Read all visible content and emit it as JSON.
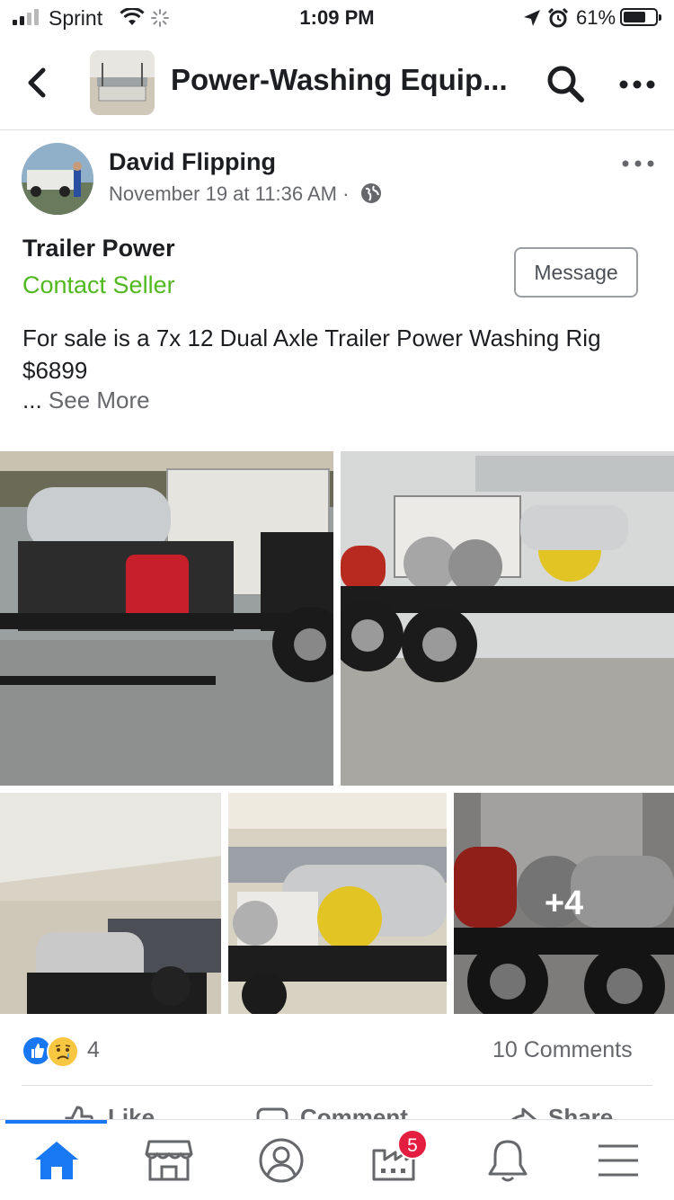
{
  "status_bar": {
    "carrier": "Sprint",
    "time": "1:09 PM",
    "battery": "61%"
  },
  "header": {
    "group_title": "Power-Washing Equip..."
  },
  "post": {
    "author": "David Flipping",
    "timestamp": "November 19 at 11:36 AM ·",
    "listing_title": "Trailer Power",
    "contact_label": "Contact Seller",
    "message_label": "Message",
    "description": "For sale is  a 7x 12 Dual Axle Trailer Power Washing Rig $6899",
    "see_more_dots": "...",
    "see_more_label": "See More",
    "extra_photos": "+4"
  },
  "engagement": {
    "reaction_count": "4",
    "comments_label": "10 Comments",
    "actions": [
      "Like",
      "Comment",
      "Share"
    ]
  },
  "tabbar": {
    "notification_badge": "5"
  },
  "colors": {
    "accent": "#1877f2",
    "contact_green": "#52b820",
    "badge_red": "#e41e3f"
  }
}
